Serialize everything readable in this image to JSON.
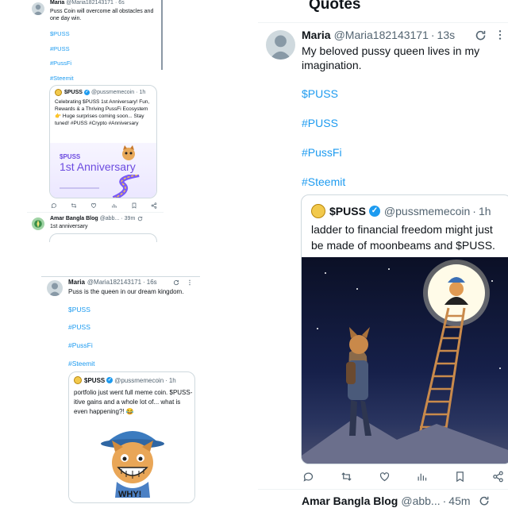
{
  "p1": {
    "main": {
      "name": "Maria",
      "handle": "@Maria182143171",
      "sep": "·",
      "time": "6s",
      "text": "Puss Coin will overcome all obstacles and one day win.",
      "hashtags": [
        "$PUSS",
        "#PUSS",
        "#PussFi",
        "#Steemit"
      ]
    },
    "quote": {
      "name": "$PUSS",
      "handle": "@pussmemecoin",
      "sep": "·",
      "time": "1h",
      "text": "Celebrating $PUSS 1st Anniversary! Fun, Rewards & a Thriving PussFi Ecosystem 👉 Huge surprises coming soon... Stay tuned! #PUSS #Crypto #Anniversary",
      "image_title1": "$PUSS",
      "image_title2": "1st Anniversary"
    },
    "next": {
      "name": "Amar Bangla Blog",
      "handle": "@abb...",
      "sep": "·",
      "time": "39m",
      "text": "1st anniversary"
    }
  },
  "p2": {
    "main": {
      "name": "Maria",
      "handle": "@Maria182143171",
      "sep": "·",
      "time": "16s",
      "text": "Puss is the queen in our dream kingdom.",
      "hashtags": [
        "$PUSS",
        "#PUSS",
        "#PussFi",
        "#Steemit"
      ]
    },
    "quote": {
      "name": "$PUSS",
      "handle": "@pussmemecoin",
      "sep": "·",
      "time": "1h",
      "text": "portfolio just went full meme coin. $PUSS-itive gains and a whole lot of... what is even happening?! 😂",
      "image_caption": "WHY!"
    }
  },
  "p3": {
    "header": "Quotes",
    "main": {
      "name": "Maria",
      "handle": "@Maria182143171",
      "sep": "·",
      "time": "13s",
      "text": "My beloved pussy queen lives in my imagination.",
      "hashtags": [
        "$PUSS",
        "#PUSS",
        "#PussFi",
        "#Steemit"
      ]
    },
    "quote": {
      "name": "$PUSS",
      "handle": "@pussmemecoin",
      "sep": "·",
      "time": "1h",
      "text": "ladder to financial freedom might just be made of moonbeams and $PUSS."
    },
    "next": {
      "name": "Amar Bangla Blog",
      "handle": "@abb...",
      "sep": "·",
      "time": "45m"
    }
  },
  "colors": {
    "link": "#1d9bf0",
    "text": "#0f1419",
    "muted": "#536471",
    "border": "#cfd9de"
  },
  "icons": [
    "reply-icon",
    "retweet-icon",
    "like-icon",
    "views-icon",
    "bookmark-icon",
    "share-icon",
    "more-icon",
    "refresh-icon",
    "verified-icon"
  ]
}
